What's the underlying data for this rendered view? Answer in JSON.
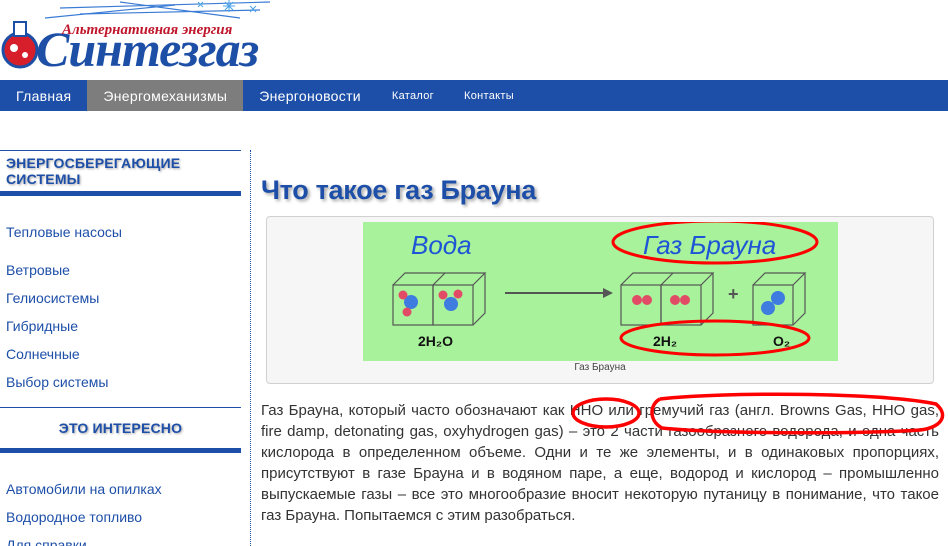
{
  "site": {
    "tagline": "Альтернативная энергия",
    "name": "Синтезгаз"
  },
  "nav": {
    "items": [
      {
        "label": "Главная"
      },
      {
        "label": "Энергомеханизмы"
      },
      {
        "label": "Энергоновости"
      },
      {
        "label": "Каталог"
      },
      {
        "label": "Контакты"
      }
    ],
    "active_index": 1
  },
  "sidebar": {
    "section1": {
      "title": "ЭНЕРГОСБЕРЕГАЮЩИЕ СИСТЕМЫ",
      "items": [
        "Тепловые насосы",
        "Ветровые",
        "Гелиосистемы",
        "Гибридные",
        "Солнечные",
        "Выбор системы"
      ]
    },
    "section2": {
      "title": "ЭТО ИНТЕРЕСНО",
      "items": [
        "Автомобили на опилках",
        "Водородное топливо",
        "Для справки"
      ]
    }
  },
  "article": {
    "title": "Что такое газ Брауна",
    "figure": {
      "label_left": "Вода",
      "label_right": "Газ Брауна",
      "formula_left": "2H₂O",
      "formula_mid": "2H₂",
      "formula_right": "O₂",
      "plus": "+",
      "caption": "Газ Брауна"
    },
    "body": "Газ Брауна, который часто обозначают как HHO или гремучий газ (англ. Browns Gas, HHO gas, fire damp, detonating gas, oxyhydrogen gas) – это 2 части газообразного водорода, и одна часть кислорода в определенном объеме. Одни и те же элементы, и в одинаковых пропорциях, присутствуют в газе Брауна и в водяном паре, а еще, водород и кислород – промышленно выпускаемые газы – все это многообразие вносит некоторую путаницу в понимание, что такое газ Брауна. Попытаемся с этим разобраться."
  },
  "colors": {
    "brand_blue": "#1d4fa8",
    "active_tab": "#7d7d7d",
    "tagline_red": "#c0162c",
    "diagram_bg": "#a7f29a",
    "annotation_red": "#ff0000"
  }
}
